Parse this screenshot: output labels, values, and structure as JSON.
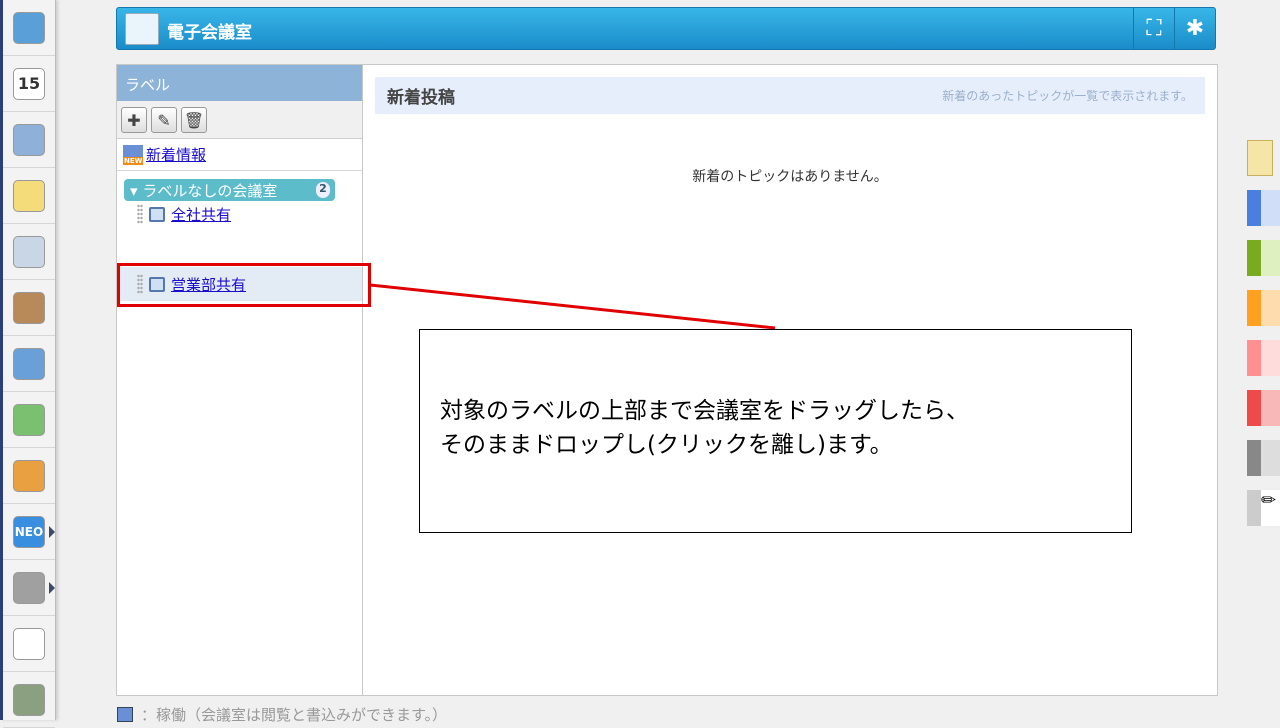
{
  "app": {
    "title": "電子会議室"
  },
  "header": {
    "fullscreen_icon": "expand-icon",
    "settings_icon": "gear-icon"
  },
  "leftbar": {
    "items": [
      {
        "name": "portal",
        "color": "#5a9fd8",
        "label": ""
      },
      {
        "name": "calendar",
        "color": "#ffffff",
        "label": "15"
      },
      {
        "name": "facility",
        "color": "#8fb0d8",
        "label": ""
      },
      {
        "name": "memo",
        "color": "#f5dc7a",
        "label": ""
      },
      {
        "name": "bulletin",
        "color": "#c9d6e6",
        "label": ""
      },
      {
        "name": "clipboard",
        "color": "#b88a5a",
        "label": ""
      },
      {
        "name": "todo",
        "color": "#6aa0d8",
        "label": ""
      },
      {
        "name": "workflow",
        "color": "#7ac070",
        "label": ""
      },
      {
        "name": "cabinet",
        "color": "#e8a040",
        "label": ""
      },
      {
        "name": "neo",
        "color": "#3a8ee0",
        "label": "NEO",
        "arrow": true
      },
      {
        "name": "folder",
        "color": "#a0a0a0",
        "label": "",
        "arrow": true
      },
      {
        "name": "app-link-1",
        "color": "#ffffff",
        "label": ""
      },
      {
        "name": "app-link-2",
        "color": "#8aa080",
        "label": ""
      }
    ]
  },
  "labels": {
    "title": "ラベル",
    "new_info": "新着情報",
    "new_badge": "NEW",
    "group": {
      "name": "ラベルなしの会議室",
      "count": "2"
    },
    "rooms": [
      "全社共有",
      "営業部共有"
    ]
  },
  "main": {
    "title": "新着投稿",
    "subtitle": "新着のあったトピックが一覧で表示されます。",
    "empty": "新着のトピックはありません。"
  },
  "callout": {
    "line1": "対象のラベルの上部まで会議室をドラッグしたら、",
    "line2": "そのままドロップし(クリックを離し)ます。"
  },
  "footer": {
    "legend": "：稼働（会議室は閲覧と書込みができます。）"
  },
  "colors": {
    "header": "#1a8cc9",
    "label_head": "#8eb3d9",
    "group": "#5cbcc9",
    "highlight": "#e00000"
  },
  "swatches": [
    {
      "dark": "#4a7fe0",
      "light": "#d0def8"
    },
    {
      "dark": "#7aaa20",
      "light": "#def0c0"
    },
    {
      "dark": "#ffa020",
      "light": "#ffdcae"
    },
    {
      "dark": "#ff9090",
      "light": "#ffdcdc"
    },
    {
      "dark": "#ee4a4a",
      "light": "#f8b8b8"
    },
    {
      "dark": "#888888",
      "light": "#dddddd"
    }
  ]
}
